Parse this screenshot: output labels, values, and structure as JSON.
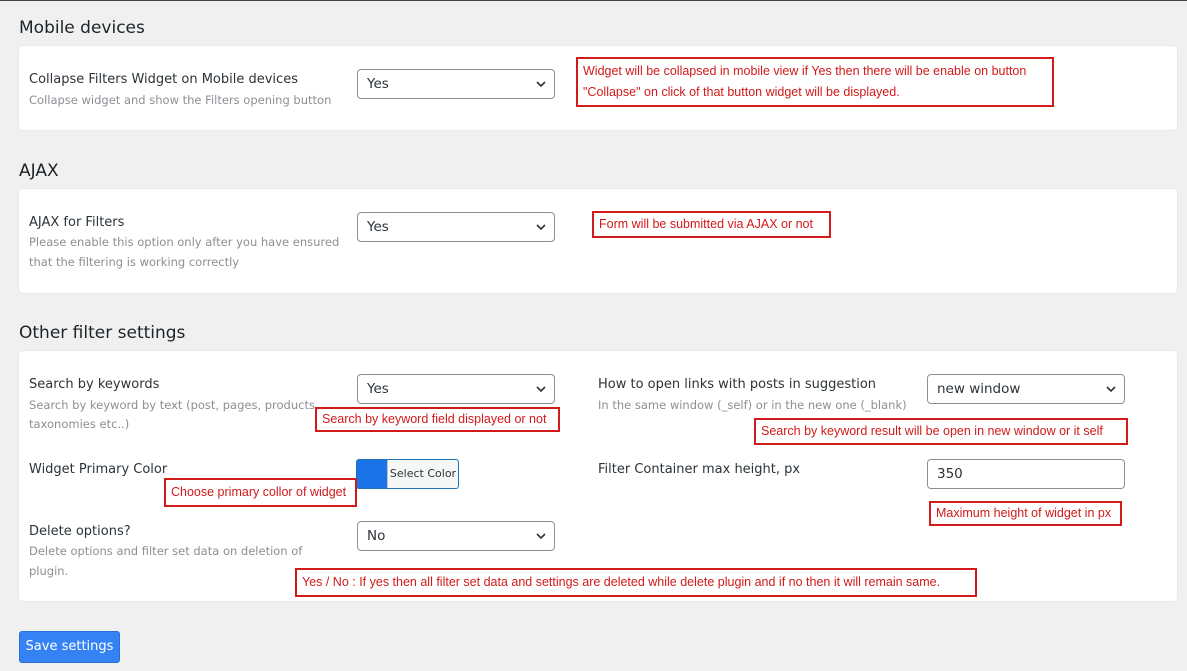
{
  "sections": {
    "mobile": {
      "title": "Mobile devices",
      "field": {
        "label": "Collapse Filters Widget on Mobile devices",
        "description": "Collapse widget and show the Filters opening button",
        "value": "Yes"
      },
      "note_line1": "Widget will be collapsed in mobile view if Yes then there will be enable on button",
      "note_line2": "\"Collapse\" on click of that button widget will be displayed."
    },
    "ajax": {
      "title": "AJAX",
      "field": {
        "label": "AJAX for Filters",
        "description_line1": "Please enable this option only after you have ensured",
        "description_line2": "that the filtering is working correctly",
        "value": "Yes"
      },
      "note": "Form will be submitted via AJAX or not"
    },
    "other": {
      "title": "Other filter settings",
      "search_keywords": {
        "label": "Search by keywords",
        "description_line1": "Search by keyword by text (post, pages, products,",
        "description_line2": "taxonomies etc..)",
        "value": "Yes",
        "note": "Search by keyword field displayed or not"
      },
      "open_links": {
        "label": "How to open links with posts in suggestion",
        "description": "In the same window (_self) or in the new one (_blank)",
        "value": "new window",
        "note": "Search by keyword result will be open in new window or it self"
      },
      "primary_color": {
        "label": "Widget Primary Color",
        "button": "Select Color",
        "swatch_color": "#1a73e8",
        "note": "Choose primary collor of widget"
      },
      "max_height": {
        "label": "Filter Container max height, px",
        "value": "350",
        "note": "Maximum height of widget in px"
      },
      "delete_options": {
        "label": "Delete options?",
        "description_line1": "Delete options and filter set data on deletion of",
        "description_line2": "plugin.",
        "value": "No",
        "note": "Yes / No : If yes then all filter set data and settings are deleted while delete plugin and if no then it will remain same."
      }
    }
  },
  "save_button": "Save settings",
  "icons": {
    "dropdown": "chevron-down-icon"
  },
  "colors": {
    "accent": "#3582f5",
    "annotation": "#d11a1a"
  }
}
